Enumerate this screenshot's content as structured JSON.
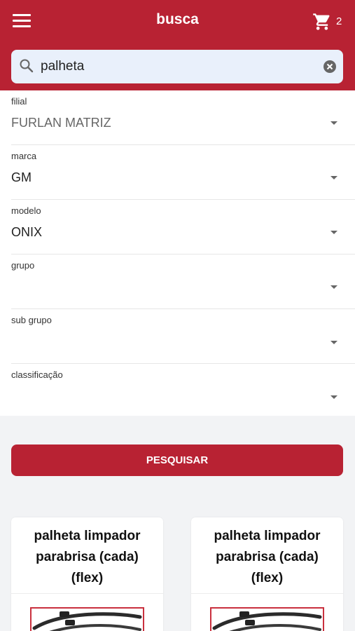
{
  "header": {
    "title": "busca",
    "menu_icon": "menu-icon",
    "cart_icon": "cart-icon",
    "cart_count": "2",
    "bg_color": "#b82233"
  },
  "search": {
    "value": "palheta",
    "search_icon": "search-icon",
    "clear_icon": "clear-icon"
  },
  "filters": [
    {
      "label": "filial",
      "value": "FURLAN MATRIZ"
    },
    {
      "label": "marca",
      "value": "GM"
    },
    {
      "label": "modelo",
      "value": "ONIX"
    },
    {
      "label": "grupo",
      "value": ""
    },
    {
      "label": "sub grupo",
      "value": ""
    },
    {
      "label": "classificação",
      "value": ""
    }
  ],
  "actions": {
    "search_label": "PESQUISAR"
  },
  "products": [
    {
      "title": "palheta limpador parabrisa (cada) (flex)",
      "image": "wiper-blade-image"
    },
    {
      "title": "palheta limpador parabrisa (cada) (flex)",
      "image": "wiper-blade-image"
    }
  ]
}
